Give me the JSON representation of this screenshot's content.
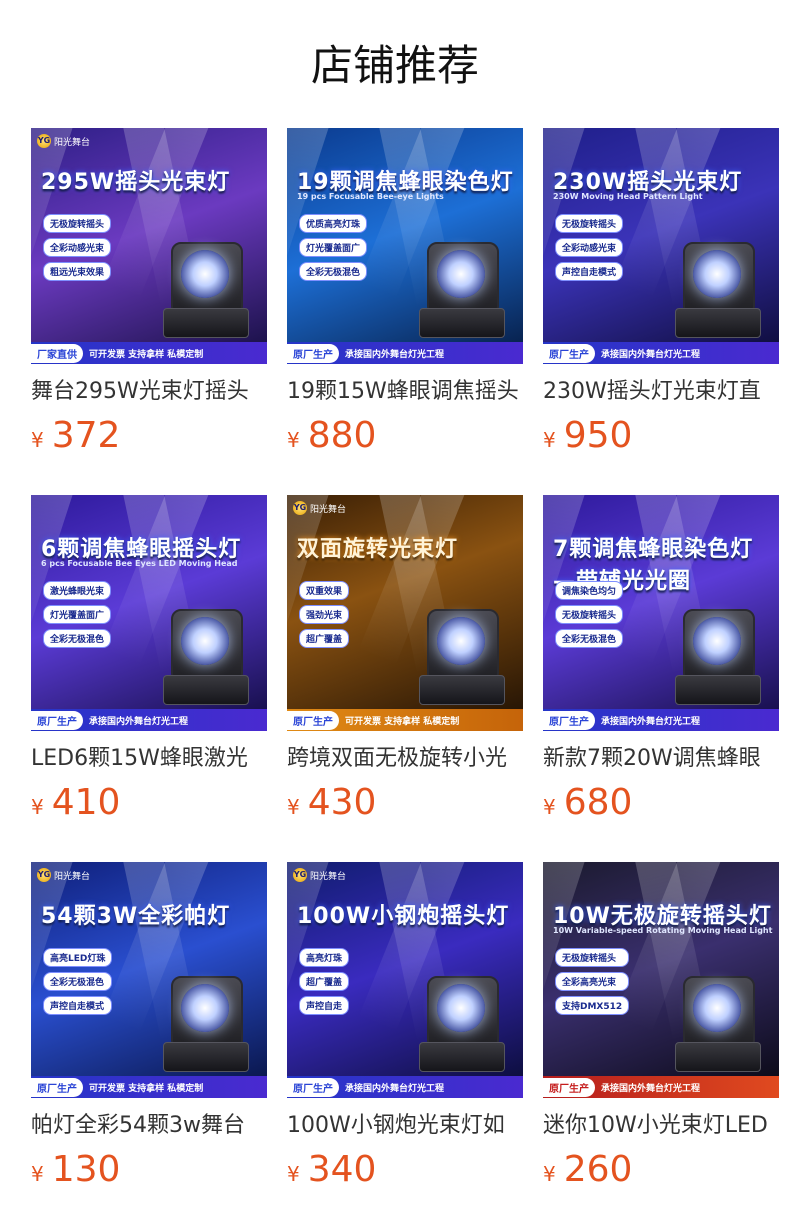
{
  "section": {
    "title": "店铺推荐"
  },
  "currency_symbol": "¥",
  "products": [
    {
      "name": "舞台295W光束灯摇头",
      "price": "372",
      "image": {
        "headline": "295W摇头光束灯",
        "subline": "",
        "features": [
          "无极旋转摇头",
          "全彩动感光束",
          "粗远光束效果"
        ],
        "badge": "厂家直供",
        "slogan": "可开发票 支持拿样 私模定制",
        "logo": "阳光舞台",
        "theme": "purple"
      }
    },
    {
      "name": "19颗15W蜂眼调焦摇头",
      "price": "880",
      "image": {
        "headline": "19颗调焦蜂眼染色灯",
        "subline": "19 pcs Focusable Bee-eye Lights",
        "features": [
          "优质高亮灯珠",
          "灯光覆盖面广",
          "全彩无极混色"
        ],
        "badge": "原厂生产",
        "slogan": "承接国内外舞台灯光工程",
        "logo": "",
        "theme": "blue"
      }
    },
    {
      "name": "230W摇头灯光束灯直",
      "price": "950",
      "image": {
        "headline": "230W摇头光束灯",
        "subline": "230W Moving Head Pattern Light",
        "features": [
          "无极旋转摇头",
          "全彩动感光束",
          "声控自走模式"
        ],
        "badge": "原厂生产",
        "slogan": "承接国内外舞台灯光工程",
        "logo": "",
        "theme": "deep"
      }
    },
    {
      "name": "LED6颗15W蜂眼激光",
      "price": "410",
      "image": {
        "headline": "6颗调焦蜂眼摇头灯",
        "subline": "6 pcs Focusable Bee Eyes LED Moving Head",
        "features": [
          "激光蜂眼光束",
          "灯光覆盖面广",
          "全彩无极混色"
        ],
        "badge": "原厂生产",
        "slogan": "承接国内外舞台灯光工程",
        "logo": "",
        "theme": "violet"
      }
    },
    {
      "name": "跨境双面无极旋转小光",
      "price": "430",
      "image": {
        "headline": "双面旋转光束灯",
        "subline": "",
        "features": [
          "双重效果",
          "强劲光束",
          "超广覆盖"
        ],
        "badge": "原厂生产",
        "slogan": "可开发票 支持拿样 私模定制",
        "logo": "阳光舞台",
        "theme": "amber"
      }
    },
    {
      "name": "新款7颗20W调焦蜂眼",
      "price": "680",
      "image": {
        "headline": "7颗调焦蜂眼染色灯 —带辅光光圈",
        "subline": "",
        "features": [
          "调焦染色均匀",
          "无极旋转摇头",
          "全彩无极混色"
        ],
        "badge": "原厂生产",
        "slogan": "承接国内外舞台灯光工程",
        "logo": "",
        "theme": "violet"
      }
    },
    {
      "name": "帕灯全彩54颗3w舞台",
      "price": "130",
      "image": {
        "headline": "54颗3W全彩帕灯",
        "subline": "",
        "features": [
          "高亮LED灯珠",
          "全彩无极混色",
          "声控自走模式"
        ],
        "badge": "原厂生产",
        "slogan": "可开发票 支持拿样 私模定制",
        "logo": "阳光舞台",
        "theme": "navy"
      }
    },
    {
      "name": "100W小钢炮光束灯如",
      "price": "340",
      "image": {
        "headline": "100W小钢炮摇头灯",
        "subline": "",
        "features": [
          "高亮灯珠",
          "超广覆盖",
          "声控自走"
        ],
        "badge": "原厂生产",
        "slogan": "承接国内外舞台灯光工程",
        "logo": "阳光舞台",
        "theme": "indigo"
      }
    },
    {
      "name": "迷你10W小光束灯LED",
      "price": "260",
      "image": {
        "headline": "10W无极旋转摇头灯",
        "subline": "10W Variable-speed Rotating Moving Head Light",
        "features": [
          "无极旋转摇头",
          "全彩高亮光束",
          "支持DMX512"
        ],
        "badge": "原厂生产",
        "slogan": "承接国内外舞台灯光工程",
        "logo": "",
        "theme": "dark"
      }
    }
  ]
}
